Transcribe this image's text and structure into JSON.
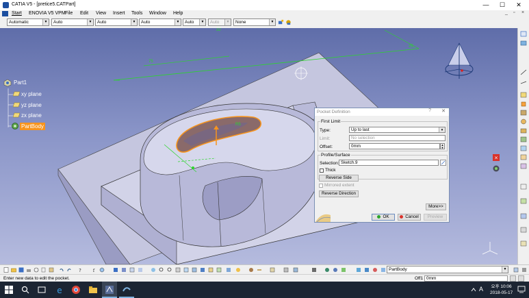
{
  "window": {
    "title": "CATIA V5 - [pretice5.CATPart]"
  },
  "menu": {
    "items": [
      "Start",
      "ENOVIA V5 VPM",
      "File",
      "Edit",
      "View",
      "Insert",
      "Tools",
      "Window",
      "Help"
    ],
    "mdi_min": "_",
    "mdi_restore": "▫",
    "mdi_close": "×"
  },
  "win_controls": {
    "minimize": "—",
    "maximize": "☐",
    "close": "✕"
  },
  "toolbar_top": {
    "combos": [
      "Automatic",
      "Auto",
      "Auto",
      "Auto",
      "Auto",
      "Auto",
      "None"
    ]
  },
  "tree": {
    "root": "Part1",
    "items": [
      "xy plane",
      "yz plane",
      "zx plane"
    ],
    "active": "PartBody"
  },
  "dimensions": {
    "d1": "32",
    "d2": "75",
    "d3": "25",
    "d4": "R5"
  },
  "dialog": {
    "title": "Pocket Definition",
    "help": "?",
    "close": "✕",
    "first_limit": {
      "group_label": "First Limit",
      "type_label": "Type:",
      "type_value": "Up to last",
      "limit_label": "Limit:",
      "limit_value": "No selection",
      "offset_label": "Offset:",
      "offset_value": "0mm"
    },
    "profile": {
      "group_label": "Profile/Surface",
      "selection_label": "Selection:",
      "selection_value": "Sketch.9",
      "thick_label": "Thick",
      "reverse_side": "Reverse Side"
    },
    "mirrored_extent": "Mirrored extent",
    "reverse_direction": "Reverse Direction",
    "more": "More>>",
    "ok": "OK",
    "cancel": "Cancel",
    "preview": "Preview"
  },
  "bottom_toolbar": {
    "body_combo": "PartBody"
  },
  "status": {
    "message": "Enter new data to edit the pocket.",
    "field_label": "Off1",
    "field_value": "0mm"
  },
  "taskbar": {
    "time": "오후 10:06",
    "date": "2018-05-17",
    "lang": "A"
  },
  "colors": {
    "viewport_top": "#5f6da9",
    "part_face": "#c4c4de",
    "highlight": "#f7941d",
    "sketch": "#2bd62b"
  }
}
